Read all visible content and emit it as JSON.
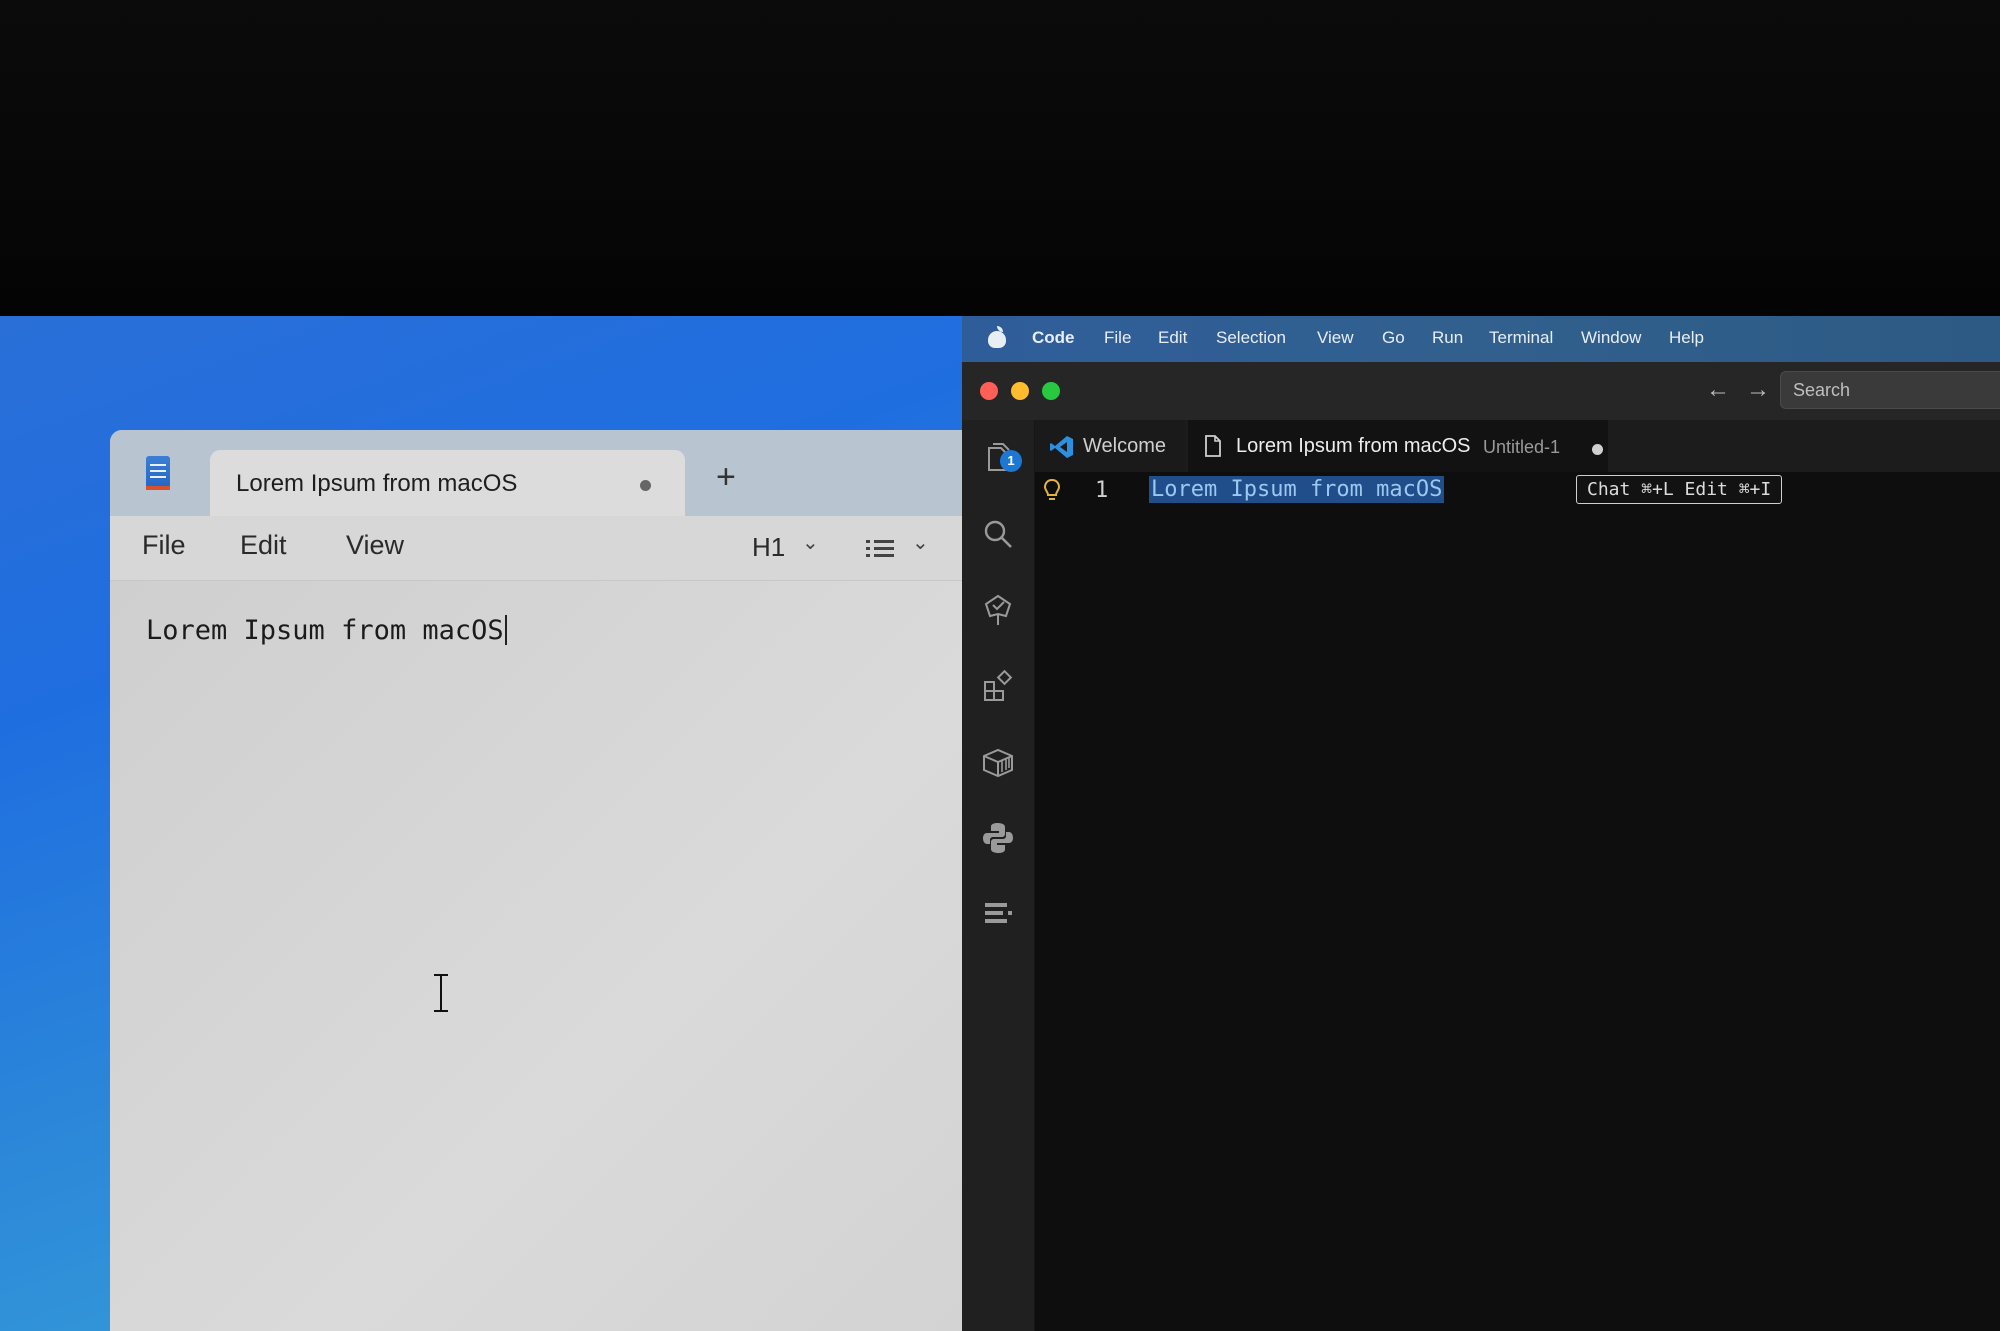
{
  "notepad": {
    "tab_title": "Lorem Ipsum from macOS",
    "new_tab": "+",
    "menu": [
      "File",
      "Edit",
      "View"
    ],
    "heading_select": "H1",
    "editor_text": "Lorem Ipsum from macOS",
    "icons": [
      "notepad-app-icon",
      "unsaved-dot-icon",
      "chevron-down-icon",
      "list-icon",
      "text-cursor-icon"
    ]
  },
  "mac_menubar": {
    "app": "Code",
    "items": [
      "File",
      "Edit",
      "Selection",
      "View",
      "Go",
      "Run",
      "Terminal",
      "Window",
      "Help"
    ]
  },
  "vscode": {
    "window_controls": {
      "close": "#ff5f57",
      "minimize": "#febc2e",
      "zoom": "#28c840"
    },
    "nav_back": "←",
    "nav_forward": "→",
    "search_placeholder": "Search",
    "explorer_badge": "1",
    "activity_icons": [
      "files-icon",
      "search-icon",
      "source-control-icon",
      "extensions-icon",
      "remote-explorer-icon",
      "python-icon",
      "outline-icon"
    ],
    "tabs": {
      "welcome": "Welcome",
      "active_label": "Lorem Ipsum from macOS",
      "active_subtitle": "Untitled-1"
    },
    "editor": {
      "line_number": "1",
      "line_text": "Lorem Ipsum from macOS",
      "inline_hint": "Chat ⌘+L Edit ⌘+I"
    },
    "colors": {
      "selection": "#1f4e8a",
      "badge": "#1d78d4",
      "vscode_logo": "#2d8fe0"
    }
  }
}
